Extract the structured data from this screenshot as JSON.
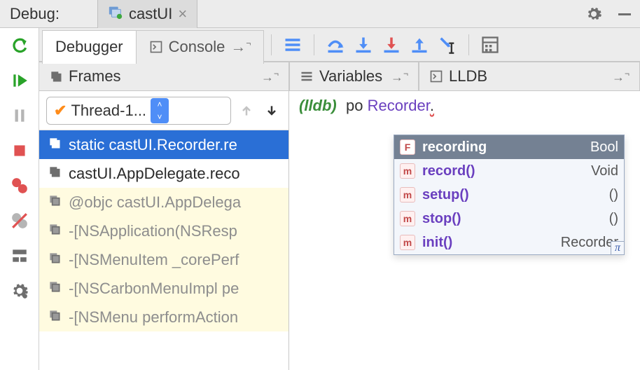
{
  "top": {
    "debug_label": "Debug:",
    "tab_name": "castUI"
  },
  "toolbar": {
    "tab_debugger": "Debugger",
    "tab_console": "Console"
  },
  "panels": {
    "frames": "Frames",
    "variables": "Variables",
    "lldb": "LLDB"
  },
  "thread": {
    "name": "Thread-1..."
  },
  "frames": [
    {
      "label": "static castUI.Recorder.re",
      "state": "selected"
    },
    {
      "label": "castUI.AppDelegate.reco",
      "state": "dark"
    },
    {
      "label": "@objc castUI.AppDelega",
      "state": "dim"
    },
    {
      "label": "-[NSApplication(NSResp",
      "state": "dim"
    },
    {
      "label": "-[NSMenuItem _corePerf",
      "state": "dim"
    },
    {
      "label": "-[NSCarbonMenuImpl pe",
      "state": "dim"
    },
    {
      "label": "-[NSMenu performAction",
      "state": "dim"
    }
  ],
  "lldb_console": {
    "prompt": "(lldb)",
    "cmd_prefix": "po ",
    "object": "Recorder",
    "trailing": "."
  },
  "completions": [
    {
      "kind": "F",
      "name": "recording",
      "type": "Bool",
      "selected": true
    },
    {
      "kind": "m",
      "name": "record()",
      "type": "Void"
    },
    {
      "kind": "m",
      "name": "setup()",
      "type": "()"
    },
    {
      "kind": "m",
      "name": "stop()",
      "type": "()"
    },
    {
      "kind": "m",
      "name": "init()",
      "type": "Recorder"
    }
  ],
  "colors": {
    "selection": "#2a6fd6",
    "accent_green": "#29a329",
    "accent_red": "#e05252",
    "accent_blue": "#4f8ef7",
    "dim_bg": "#fffbe0"
  }
}
